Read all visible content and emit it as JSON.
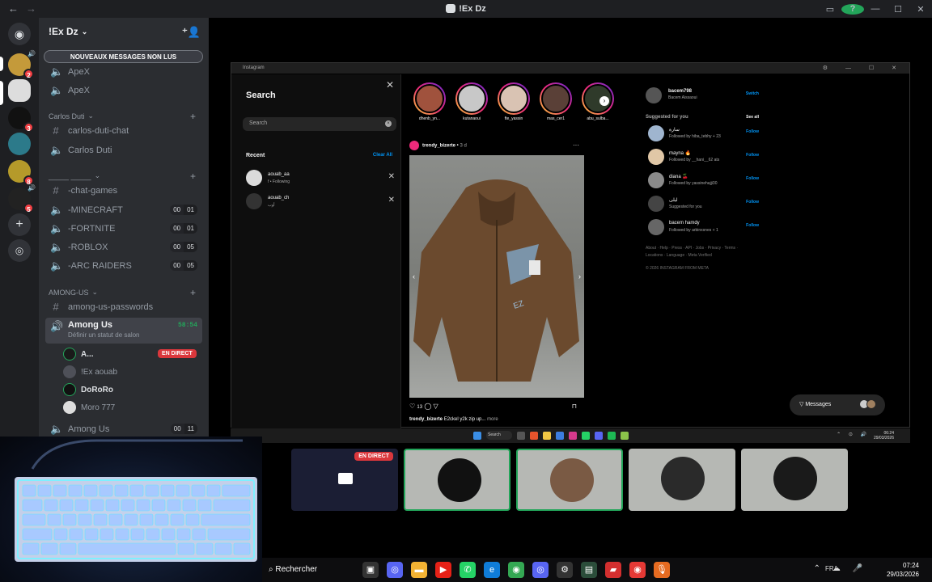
{
  "window": {
    "title": "!Ex Dz"
  },
  "server": {
    "name": "!Ex Dz"
  },
  "banner": "NOUVEAUX MESSAGES NON LUS",
  "channels_top": [
    {
      "name": "ApeX"
    },
    {
      "name": "ApeX"
    }
  ],
  "categories": [
    {
      "name": "Carlos Duti"
    },
    {
      "name": "_____ _____"
    },
    {
      "name": "AMONG-US"
    }
  ],
  "channels": [
    {
      "name": "carlos-duti-chat",
      "kind": "text"
    },
    {
      "name": "Carlos Duti",
      "kind": "voice"
    },
    {
      "name": "-chat-games",
      "kind": "text"
    },
    {
      "name": "-MINECRAFT",
      "kind": "voice",
      "c1": "00",
      "c2": "01"
    },
    {
      "name": "-FORTNITE",
      "kind": "voice",
      "c1": "00",
      "c2": "01"
    },
    {
      "name": "-ROBLOX",
      "kind": "voice",
      "c1": "00",
      "c2": "05"
    },
    {
      "name": "-ARC RAIDERS",
      "kind": "voice",
      "c1": "00",
      "c2": "05"
    },
    {
      "name": "among-us-passwords",
      "kind": "text"
    }
  ],
  "active_channel": {
    "name": "Among Us",
    "status": "Définir un statut de salon",
    "timer": "58:54"
  },
  "members": [
    {
      "name": "A...",
      "live": "EN DIRECT"
    },
    {
      "name": "!Ex aouab"
    },
    {
      "name": "DoRoRo"
    },
    {
      "name": "Moro 777"
    }
  ],
  "last_channel": {
    "name": "Among Us",
    "c1": "00",
    "c2": "11"
  },
  "server_badges": [
    "2",
    "3",
    "8",
    "5"
  ],
  "instagram": {
    "window_title": "Instagram",
    "search_title": "Search",
    "search_placeholder": "Search",
    "recent_label": "Recent",
    "clear_all": "Clear All",
    "recents": [
      {
        "name": "aouab_aa",
        "sub": "f • Following"
      },
      {
        "name": "aouab_ch",
        "sub": "أوب"
      }
    ],
    "stories": [
      "dhenb_yn...",
      "kutanaoui",
      "fte_yassin",
      "mas_cer1",
      "abu_sulba..."
    ],
    "post": {
      "user": "trendy_bizerte",
      "age": "3 d",
      "likes": "13",
      "caption_user": "trendy_bizerte",
      "caption": "E2ckel y2k zip up...",
      "more": "more"
    },
    "me": {
      "name": "bacem798",
      "sub": "Bacem Aissaoui",
      "switch": "Switch"
    },
    "suggested_label": "Suggested for you",
    "see_all": "See all",
    "suggestions": [
      {
        "name": "سارة",
        "sub": "Followed by hiba_tebhy + 23",
        "follow": "Follow"
      },
      {
        "name": "mayna 🔥",
        "sub": "Followed by __hani__62 ats",
        "follow": "Follow"
      },
      {
        "name": "diana 🍒",
        "sub": "Followed by yassinehajji30",
        "follow": "Follow"
      },
      {
        "name": "ليلى",
        "sub": "Suggested for you",
        "follow": "Follow"
      },
      {
        "name": "bacem hamdy",
        "sub": "Followed by arbinxsnes + 1",
        "follow": "Follow"
      }
    ],
    "footer": "About · Help · Press · API · Jobs · Privacy · Terms · Locations · Language · Meta Verified",
    "copyright": "© 2026 INSTAGRAM FROM META",
    "messages": "Messages"
  },
  "inner_taskbar": {
    "search": "Search",
    "time": "06:24",
    "date": "29/03/2026"
  },
  "participant_live": "EN DIRECT",
  "taskbar": {
    "search": "Rechercher",
    "lang": "FRA",
    "time": "07:24",
    "date": "29/03/2026"
  },
  "colors": {
    "accent": "#5865f2",
    "live": "#da373c",
    "speaking": "#23a55a",
    "ig_link": "#0095f6"
  }
}
